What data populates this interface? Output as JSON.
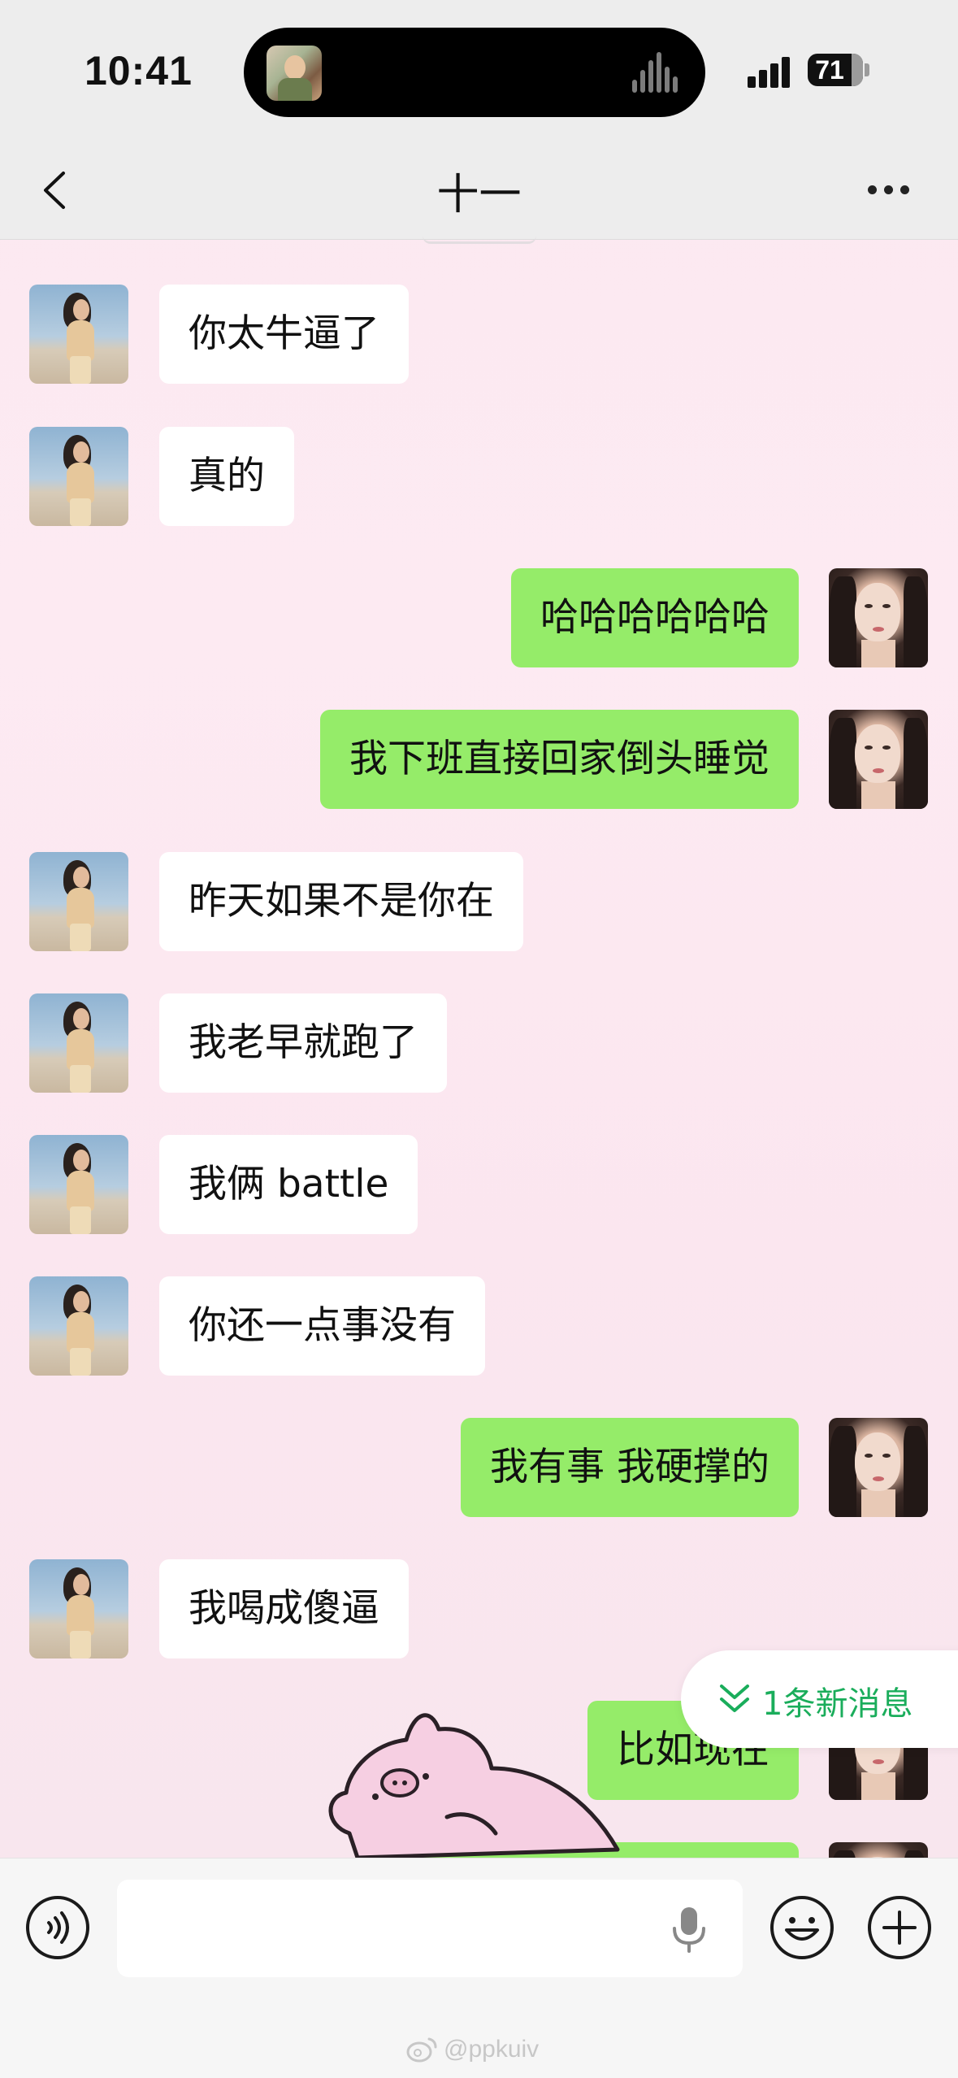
{
  "status_bar": {
    "time": "10:41",
    "battery": "71"
  },
  "header": {
    "title": "十一"
  },
  "messages": [
    {
      "side": "left",
      "text": "你太牛逼了"
    },
    {
      "side": "left",
      "text": "真的"
    },
    {
      "side": "right",
      "text": "哈哈哈哈哈哈"
    },
    {
      "side": "right",
      "text": "我下班直接回家倒头睡觉"
    },
    {
      "side": "left",
      "text": "昨天如果不是你在"
    },
    {
      "side": "left",
      "text": "我老早就跑了"
    },
    {
      "side": "left",
      "text": "我俩 battle"
    },
    {
      "side": "left",
      "text": "你还一点事没有"
    },
    {
      "side": "right",
      "text": "我有事 我硬撑的"
    },
    {
      "side": "left",
      "text": "我喝成傻逼"
    },
    {
      "side": "right",
      "text": "比如现在"
    }
  ],
  "new_message_pill": {
    "text": "1条新消息"
  },
  "input": {
    "placeholder": ""
  },
  "watermark": "@ppkuiv",
  "colors": {
    "sent_bubble": "#95ec69",
    "received_bubble": "#ffffff",
    "accent": "#1aad5b"
  }
}
